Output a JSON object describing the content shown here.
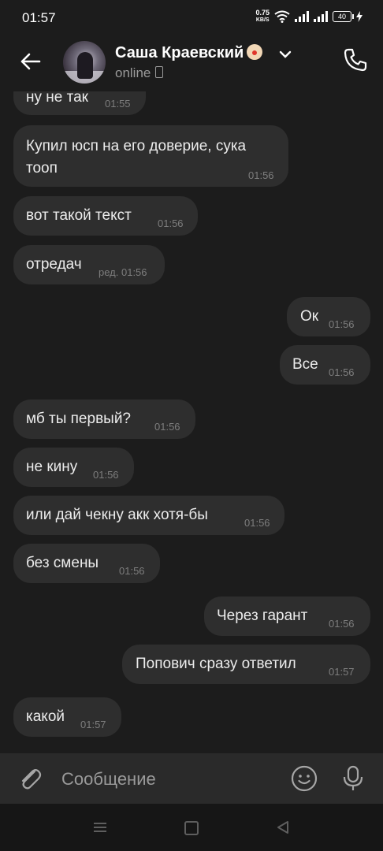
{
  "status_bar": {
    "time": "01:57",
    "speed_value": "0.75",
    "speed_unit": "KB/S",
    "battery": "40"
  },
  "header": {
    "name": "Саша Краевский",
    "status": "online",
    "icons": [
      "back-arrow-icon",
      "clown-emoji-icon",
      "chevron-down-icon",
      "mobile-phone-icon",
      "phone-call-icon"
    ]
  },
  "messages": [
    {
      "text": "ну не так",
      "time": "01:55",
      "side": "in"
    },
    {
      "text": "Купил юсп на его доверие, сука",
      "text2": "тооп",
      "time": "01:56",
      "side": "in"
    },
    {
      "text": "вот такой текст",
      "time": "01:56",
      "side": "in"
    },
    {
      "text": "отредач",
      "time": "ред. 01:56",
      "side": "in"
    },
    {
      "text": "Ок",
      "time": "01:56",
      "side": "out"
    },
    {
      "text": "Все",
      "time": "01:56",
      "side": "out"
    },
    {
      "text": "мб ты первый?",
      "time": "01:56",
      "side": "in"
    },
    {
      "text": "не кину",
      "time": "01:56",
      "side": "in"
    },
    {
      "text": "или дай чекну акк хотя-бы",
      "time": "01:56",
      "side": "in"
    },
    {
      "text": "без смены",
      "time": "01:56",
      "side": "in"
    },
    {
      "text": "Через гарант",
      "time": "01:56",
      "side": "out"
    },
    {
      "text": "Попович сразу ответил",
      "time": "01:57",
      "side": "out"
    },
    {
      "text": "какой",
      "time": "01:57",
      "side": "in"
    }
  ],
  "input": {
    "placeholder": "Сообщение",
    "icons": [
      "paperclip-icon",
      "smile-icon",
      "microphone-icon"
    ]
  },
  "nav": {
    "icons": [
      "recent-apps-icon",
      "home-icon",
      "back-triangle-icon"
    ]
  },
  "colors": {
    "background": "#1c1c1c",
    "bubble": "#2e2e2e",
    "input_bar": "#2a2a2a",
    "text": "#ececec",
    "muted": "#7d7d7d"
  }
}
